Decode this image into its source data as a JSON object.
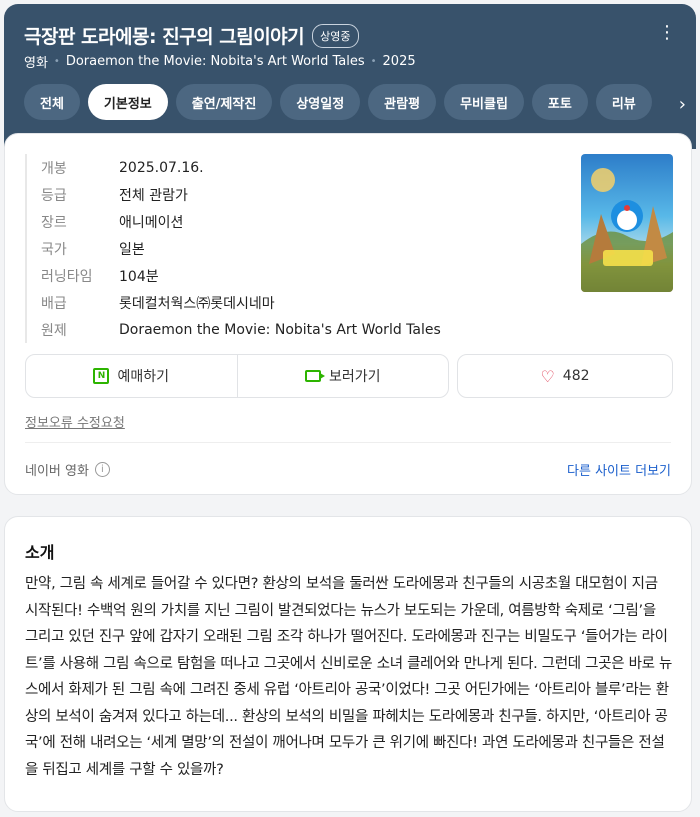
{
  "header": {
    "title": "극장판 도라에몽: 진구의 그림이야기",
    "badge": "상영중",
    "category": "영화",
    "original_title": "Doraemon the Movie: Nobita's Art World Tales",
    "year": "2025",
    "more_icon": "⋮"
  },
  "tabs": [
    {
      "label": "전체"
    },
    {
      "label": "기본정보"
    },
    {
      "label": "출연/제작진"
    },
    {
      "label": "상영일정"
    },
    {
      "label": "관람평"
    },
    {
      "label": "무비클립"
    },
    {
      "label": "포토"
    },
    {
      "label": "리뷰"
    }
  ],
  "active_tab": "기본정보",
  "info": [
    {
      "label": "개봉",
      "value": "2025.07.16."
    },
    {
      "label": "등급",
      "value": "전체 관람가"
    },
    {
      "label": "장르",
      "value": "애니메이션"
    },
    {
      "label": "국가",
      "value": "일본"
    },
    {
      "label": "러닝타임",
      "value": "104분"
    },
    {
      "label": "배급",
      "value": "롯데컬처웍스㈜롯데시네마"
    },
    {
      "label": "원제",
      "value": "Doraemon the Movie: Nobita's Art World Tales"
    }
  ],
  "actions": {
    "booking": "예매하기",
    "watch": "보러가기",
    "likes": "482"
  },
  "report_link": "정보오류 수정요청",
  "source": "네이버 영화",
  "other_sites": "다른 사이트 더보기",
  "intro": {
    "title": "소개",
    "text": "만약, 그림 속 세계로 들어갈 수 있다면? 환상의 보석을 둘러싼 도라에몽과 친구들의 시공초월 대모험이 지금 시작된다! 수백억 원의 가치를 지닌 그림이 발견되었다는 뉴스가 보도되는 가운데, 여름방학 숙제로 ‘그림’을 그리고 있던 진구 앞에 갑자기 오래된 그림 조각 하나가 떨어진다. 도라에몽과 진구는 비밀도구 ‘들어가는 라이트’를 사용해 그림 속으로 탐험을 떠나고 그곳에서 신비로운 소녀 클레어와 만나게 된다. 그런데 그곳은 바로 뉴스에서 화제가 된 그림 속에 그려진 중세 유럽 ‘아트리아 공국’이었다! 그곳 어딘가에는 ‘아트리아 블루’라는 환상의 보석이 숨겨져 있다고 하는데... 환상의 보석의 비밀을 파헤치는 도라에몽과 친구들. 하지만, ‘아트리아 공국’에 전해 내려오는 ‘세계 멸망’의 전설이 깨어나며 모두가 큰 위기에 빠진다! 과연 도라에몽과 친구들은 전설을 뒤집고 세계를 구할 수 있을까?"
  }
}
